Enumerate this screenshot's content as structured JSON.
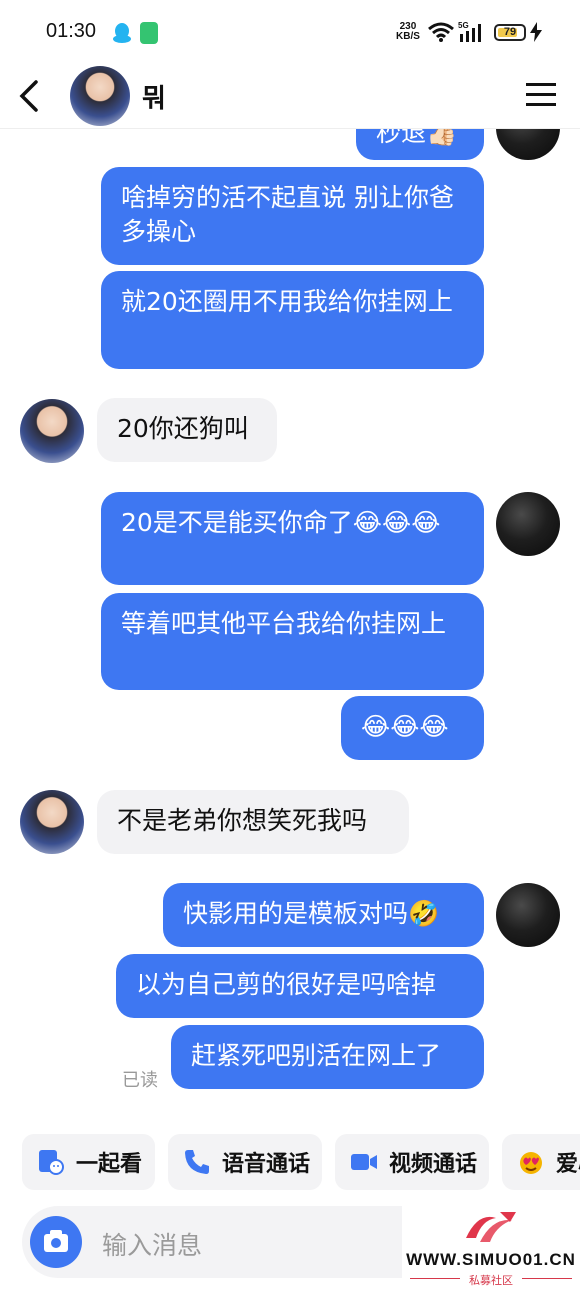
{
  "status_bar": {
    "time": "01:30",
    "net_speed_value": "230",
    "net_speed_unit": "KB/S",
    "network": "5G",
    "battery": "79"
  },
  "header": {
    "contact_name": "뭐"
  },
  "messages": [
    {
      "side": "out",
      "text": "秒退👍🏻",
      "partial": true
    },
    {
      "side": "out",
      "text": "啥掉穷的活不起直说 别让你爸多操心"
    },
    {
      "side": "out",
      "text": "就20还圈用不用我给你挂网上"
    },
    {
      "side": "in",
      "text": "20你还狗叫"
    },
    {
      "side": "out",
      "text": "20是不是能买你命了😂😂😂"
    },
    {
      "side": "out",
      "text": "等着吧其他平台我给你挂网上"
    },
    {
      "side": "out",
      "text": "😂😂😂"
    },
    {
      "side": "in",
      "text": "不是老弟你想笑死我吗"
    },
    {
      "side": "out",
      "text": "快影用的是模板对吗🤣"
    },
    {
      "side": "out",
      "text": "以为自己剪的很好是吗啥掉"
    },
    {
      "side": "out",
      "text": "赶紧死吧别活在网上了"
    }
  ],
  "read_receipt": "已读",
  "actions": [
    {
      "label": "一起看",
      "icon": "watch-together-icon"
    },
    {
      "label": "语音通话",
      "icon": "phone-icon"
    },
    {
      "label": "视频通话",
      "icon": "video-icon"
    },
    {
      "label": "爱心",
      "icon": "heart-face-icon"
    }
  ],
  "input": {
    "placeholder": "输入消息"
  },
  "watermark": {
    "url": "WWW.SIMUO01.CN",
    "sub": "私募社区"
  },
  "colors": {
    "outgoing_bubble": "#3e77f2",
    "incoming_bubble": "#f2f2f4",
    "accent": "#3e77f2"
  }
}
